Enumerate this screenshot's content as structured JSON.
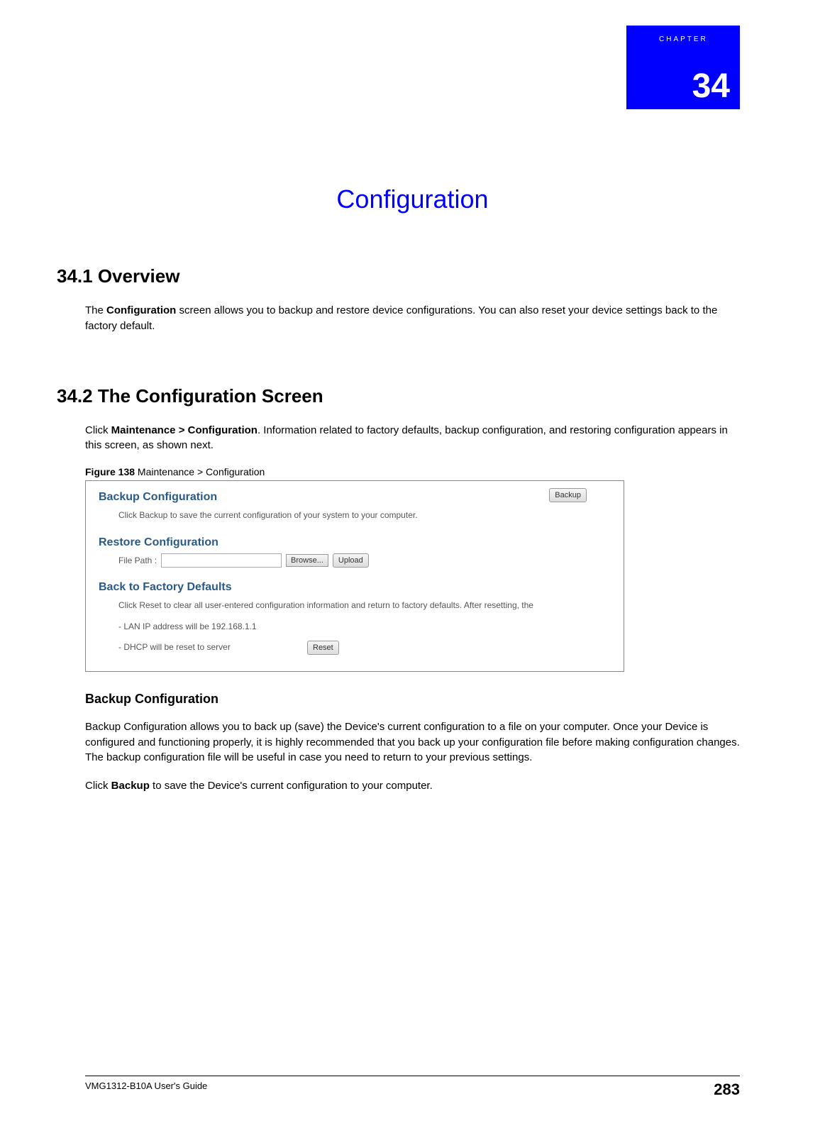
{
  "chapter": {
    "label": "CHAPTER",
    "number": "34",
    "title": "Configuration"
  },
  "section1": {
    "heading": "34.1  Overview",
    "para1_pre": "The ",
    "para1_bold": "Configuration",
    "para1_post": " screen allows you to backup and restore device configurations. You can also reset your device settings back to the factory default."
  },
  "section2": {
    "heading": "34.2  The Configuration Screen",
    "para1_pre": "Click ",
    "para1_bold": "Maintenance > Configuration",
    "para1_post": ". Information related to factory defaults, backup configuration, and restoring configuration appears in this screen, as shown next.",
    "figure_label_bold": "Figure 138",
    "figure_label_rest": "   Maintenance >  Configuration"
  },
  "figure": {
    "backup": {
      "heading": "Backup Configuration",
      "text": "Click Backup to save the current configuration of your system to your computer.",
      "button": "Backup"
    },
    "restore": {
      "heading": "Restore Configuration",
      "label": "File Path :",
      "browse": "Browse...",
      "upload": "Upload"
    },
    "factory": {
      "heading": "Back to Factory Defaults",
      "line1": "Click Reset to clear all user-entered configuration information and return to factory defaults. After resetting, the",
      "line2": "- LAN IP address will be 192.168.1.1",
      "line3": "- DHCP will be reset to server",
      "reset": "Reset"
    }
  },
  "section3": {
    "heading": "Backup Configuration",
    "para1": "Backup Configuration allows you to back up (save) the Device's current configuration to a file on your computer. Once your Device is configured and functioning properly, it is highly recommended that you back up your configuration file before making configuration changes. The backup configuration file will be useful in case you need to return to your previous settings.",
    "para2_pre": "Click ",
    "para2_bold": "Backup",
    "para2_post": " to save the Device's current configuration to your computer."
  },
  "footer": {
    "left": "VMG1312-B10A User's Guide",
    "right": "283"
  }
}
